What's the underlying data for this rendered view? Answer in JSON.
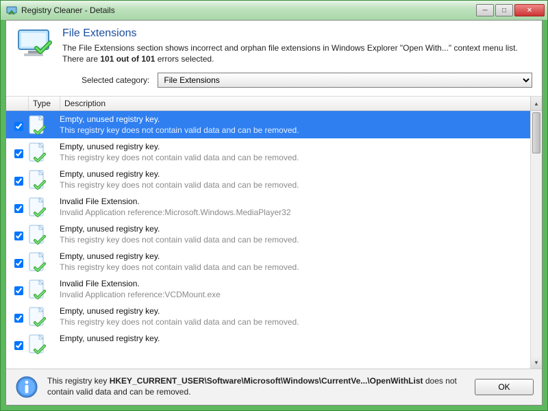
{
  "window": {
    "title": "Registry Cleaner - Details"
  },
  "header": {
    "title": "File Extensions",
    "description_pre": "The File Extensions section shows incorrect and orphan file extensions in Windows Explorer \"Open With...\" context menu list. There are ",
    "description_bold": "101 out of 101",
    "description_post": " errors selected."
  },
  "category": {
    "label": "Selected category:",
    "selected": "File Extensions",
    "options": [
      "File Extensions"
    ]
  },
  "columns": {
    "type": "Type",
    "description": "Description"
  },
  "rows": [
    {
      "checked": true,
      "selected": true,
      "title": "Empty, unused registry key.",
      "detail": "This registry key does not contain valid data and can be removed."
    },
    {
      "checked": true,
      "selected": false,
      "title": "Empty, unused registry key.",
      "detail": "This registry key does not contain valid data and can be removed."
    },
    {
      "checked": true,
      "selected": false,
      "title": "Empty, unused registry key.",
      "detail": "This registry key does not contain valid data and can be removed."
    },
    {
      "checked": true,
      "selected": false,
      "title": "Invalid File Extension.",
      "detail": "Invalid Application reference:Microsoft.Windows.MediaPlayer32"
    },
    {
      "checked": true,
      "selected": false,
      "title": "Empty, unused registry key.",
      "detail": "This registry key does not contain valid data and can be removed."
    },
    {
      "checked": true,
      "selected": false,
      "title": "Empty, unused registry key.",
      "detail": "This registry key does not contain valid data and can be removed."
    },
    {
      "checked": true,
      "selected": false,
      "title": "Invalid File Extension.",
      "detail": "Invalid Application reference:VCDMount.exe"
    },
    {
      "checked": true,
      "selected": false,
      "title": "Empty, unused registry key.",
      "detail": "This registry key does not contain valid data and can be removed."
    },
    {
      "checked": true,
      "selected": false,
      "title": "Empty, unused registry key.",
      "detail": ""
    }
  ],
  "footer": {
    "msg_pre": "This registry key ",
    "msg_path": "HKEY_CURRENT_USER\\Software\\Microsoft\\Windows\\CurrentVe...\\OpenWithList",
    "msg_post": " does not contain valid data and can be removed.",
    "ok": "OK"
  }
}
